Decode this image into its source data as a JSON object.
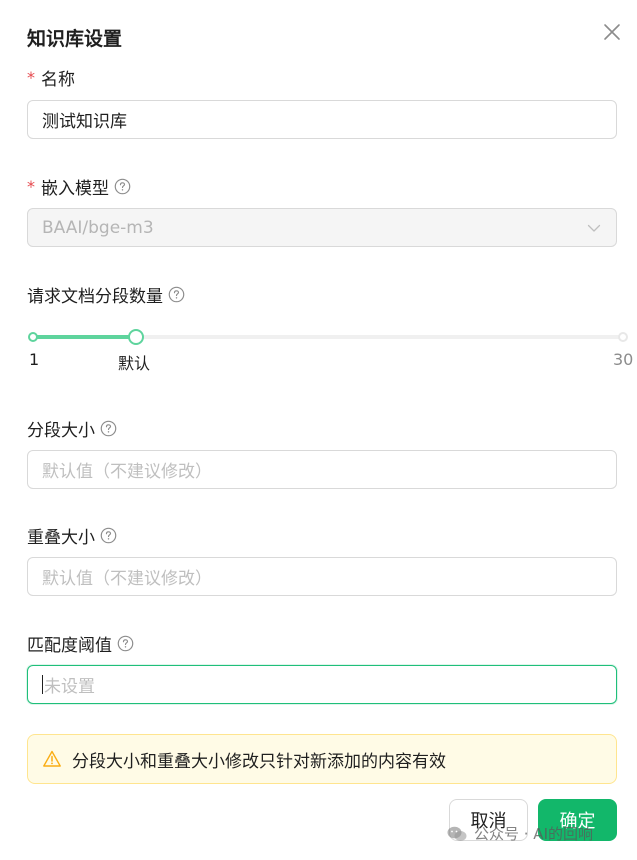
{
  "dialog": {
    "title": "知识库设置"
  },
  "fields": {
    "name": {
      "required_mark": "*",
      "label": "名称",
      "value": "测试知识库"
    },
    "embedding_model": {
      "required_mark": "*",
      "label": "嵌入模型",
      "value": "BAAI/bge-m3",
      "disabled": true
    },
    "doc_count": {
      "label": "请求文档分段数量",
      "min_label": "1",
      "default_label": "默认",
      "max_label": "30",
      "value_fraction": 0.175
    },
    "chunk_size": {
      "label": "分段大小",
      "placeholder": "默认值（不建议修改）"
    },
    "chunk_overlap": {
      "label": "重叠大小",
      "placeholder": "默认值（不建议修改）"
    },
    "threshold": {
      "label": "匹配度阈值",
      "placeholder": "未设置"
    }
  },
  "alert": {
    "text": "分段大小和重叠大小修改只针对新添加的内容有效"
  },
  "footer": {
    "cancel_label": "取消",
    "ok_label": "确定"
  },
  "watermark": {
    "text": "公众号 · AI的回响"
  },
  "colors": {
    "accent": "#12b76a",
    "slider": "#5ed49d",
    "required": "#e5484d",
    "warning": "#faad14"
  },
  "icons": {
    "close": "close-icon",
    "help": "question-circle-icon",
    "chevron": "chevron-down-icon",
    "warning": "warning-icon"
  }
}
